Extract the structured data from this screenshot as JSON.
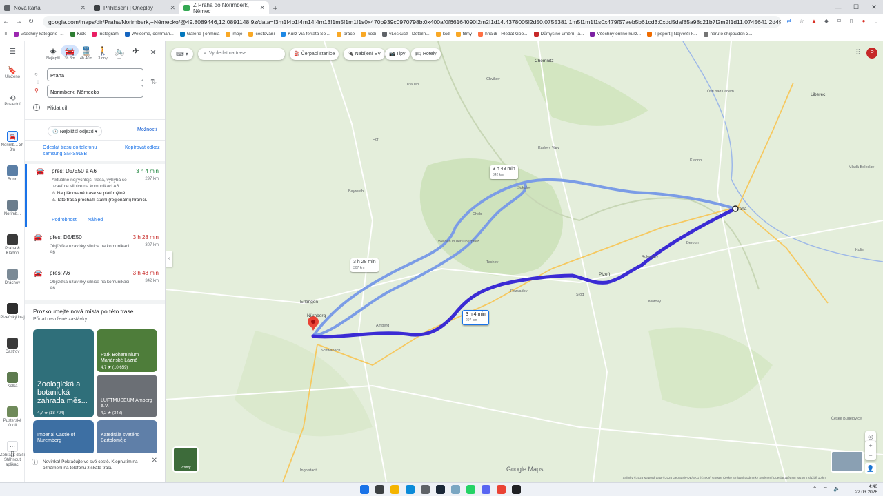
{
  "browser": {
    "tabs": [
      {
        "title": "Nová karta",
        "color": "#5f6368"
      },
      {
        "title": "Přihlášení | Oneplay",
        "color": "#3c4043"
      },
      {
        "title": "Z Praha do Norimberk, Němec",
        "color": "#34a853"
      }
    ],
    "url": "google.com/maps/dir/Praha/Norimberk,+Německo/@49.8089446,12.0891148,9z/data=!3m1!4b1!4m14!4m13!1m5!1m1!1s0x470b939c0970798b:0x400af0f66164090!2m2!1d14.4378005!2d50.0755381!1m5!1m1!1s0x479f57aeb5b61cd3:0xdd5daf85a98c21b7!2m2!1d11.0745641!2d49.4542881!3e0?authuser=0&entry=ttu&g_ep=EgoyMDI2MD...",
    "bookmarks": [
      "Všechny kategorie -...",
      "Kick",
      "Instagram",
      "Welcome, comman...",
      "Galerie | ohmnia",
      "moje",
      "cestování",
      "Kurz Via ferrata Sol...",
      "práce",
      "kodi",
      "vLeskucz - Detailn...",
      "kcd",
      "filmy",
      "hriaidi - Hledat Goo...",
      "Důmyslné umění, ja...",
      "Všechny online kurz...",
      "Tipsport | Největší k...",
      "naruto shippuden 3..."
    ]
  },
  "rail": {
    "menu": "Menu",
    "saved": "Uloženo",
    "recent": "Poslední",
    "items": [
      {
        "label": "Norimb... 3h 3m",
        "color": "#1a73e8"
      },
      {
        "label": "Bonn",
        "color": "#5b7fa6"
      },
      {
        "label": "Norimb...",
        "color": "#6b7d8c"
      },
      {
        "label": "Praha & Kladno",
        "color": "#3a3a3a"
      },
      {
        "label": "Dráchov",
        "color": "#7b8a96"
      },
      {
        "label": "Plzeňský kraj",
        "color": "#2f2f2f"
      },
      {
        "label": "Častrov",
        "color": "#3a3a3a"
      },
      {
        "label": "Kolka",
        "color": "#5e7b4f"
      },
      {
        "label": "Pusterské údolí",
        "color": "#6f8a5a"
      },
      {
        "label": "Zobrazit další",
        "color": "#ffffff"
      }
    ],
    "app": "Stáhnout aplikaci"
  },
  "panel": {
    "modes": [
      {
        "label": "Nejlepší",
        "glyph": "◈"
      },
      {
        "label": "3h 3m",
        "glyph": "🚘"
      },
      {
        "label": "4h 40m",
        "glyph": "🚆"
      },
      {
        "label": "3 dny",
        "glyph": "🚶"
      },
      {
        "label": "—",
        "glyph": "🚲"
      },
      {
        "label": "",
        "glyph": "✈"
      }
    ],
    "origin": "Praha",
    "destination": "Norimberk, Německo",
    "add_stop": "Přidat cíl",
    "depart": "Nejbližší odjezd ▾",
    "options": "Možnosti",
    "send": "Odeslat trasu do telefonu samsung SM-S918B",
    "copy": "Kopírovat odkaz",
    "routes": [
      {
        "via": "přes: D5/E50 a A6",
        "duration": "3 h 4 min",
        "distance": "297 km",
        "desc": "Aktuálně nejrychlejší trasa, vyhýbá se uzavírce silnice na komunikaci A6.",
        "warn1": "⚠ Na plánované trase se platí mýtné",
        "warn2": "⚠ Tato trasa prochází státní (regionální) hranicí.",
        "details": "Podrobnosti",
        "preview": "Náhled"
      },
      {
        "via": "přes: D5/E50",
        "duration": "3 h 28 min",
        "distance": "307 km",
        "desc": "Objížďka uzavírky silnice na komunikaci A6"
      },
      {
        "via": "přes: A6",
        "duration": "3 h 48 min",
        "distance": "342 km",
        "desc": "Objížďka uzavírky silnice na komunikaci A6"
      }
    ],
    "explore_title": "Prozkoumejte nová místa po této trase",
    "explore_sub": "Přidat navržené zastávky",
    "cards": [
      {
        "title": "Zoologická a botanická zahrada měs...",
        "rating": "4,7 ★ (18 704)",
        "color": "#2f6f7a"
      },
      {
        "title": "Park Boheminium Mariánské Lázně",
        "rating": "4,7 ★ (10 659)",
        "color": "#4e7d3a"
      },
      {
        "title": "LUFTMUSEUM Amberg e.V.",
        "rating": "4,2 ★ (348)",
        "color": "#6b6f75"
      },
      {
        "title": "Imperial Castle of Nuremberg",
        "rating": "",
        "color": "#3d6fa3"
      },
      {
        "title": "Katedrála svatého Bartoloměje",
        "rating": "",
        "color": "#5f7fa8"
      }
    ],
    "toast": "Novinka! Pokračujte ve své cestě. Klepnutím na oznámení na telefonu získáte trasu"
  },
  "map": {
    "search_placeholder": "Vyhledat na trase...",
    "chips": [
      "⛽ Čerpací stanice",
      "🔌 Nabíjení EV",
      "📷 Tipy",
      "🛏 Hotely"
    ],
    "avatar": "P",
    "route_labels": [
      {
        "time": "3 h 48 min",
        "dist": "342 km"
      },
      {
        "time": "3 h 28 min",
        "dist": "307 km"
      },
      {
        "time": "3 h 4 min",
        "dist": "297 km"
      }
    ],
    "towns": [
      "Chemnitz",
      "Chvikov",
      "Ústí nad Labem",
      "Liberec",
      "Praha",
      "Plzeň",
      "Erlangen",
      "Nürnberg",
      "Schwabach",
      "Amberg",
      "Weiden in der Oberpfalz",
      "Tachov",
      "Rozvadov",
      "Karlovy Vary",
      "Cheb",
      "České Budějovice",
      "Sokolov",
      "Kladno",
      "Beroun",
      "Rokycany",
      "Stod",
      "Klatovy",
      "Ingolstadt",
      "Bayreuth",
      "Plauen",
      "Hof",
      "Mladá Boleslav",
      "Kolín"
    ],
    "layers": "Vrstvy",
    "brand": "Google Maps",
    "footer": "Snímky ©2026 Mapová data ©2026 GeoBasis-DE/BKG (©2009) Google    Česko    Smluvní podmínky    Soukromí    Odeslat zpětnou vazbu k službě    10 km"
  },
  "taskbar": {
    "time": "4:40",
    "date": "22.03.2026"
  }
}
